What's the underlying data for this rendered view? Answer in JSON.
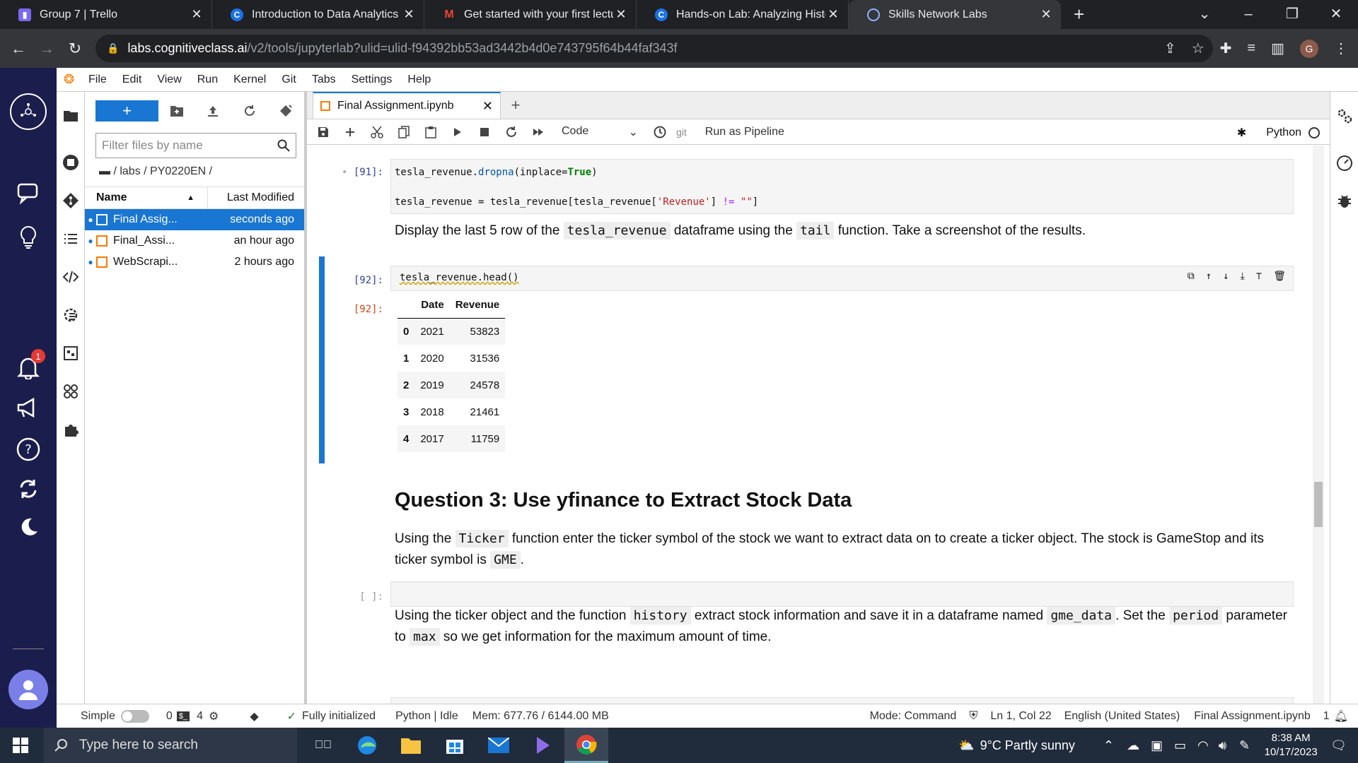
{
  "browser": {
    "tabs": [
      {
        "title": "Group 7 | Trello",
        "favicon": "trello-icon",
        "color": "#7b68ee"
      },
      {
        "title": "Introduction to Data Analytics | (",
        "favicon": "coursera-icon",
        "color": "#1a73e8"
      },
      {
        "title": "Get started with your first lectur",
        "favicon": "gmail-icon",
        "color": "#ea4335"
      },
      {
        "title": "Hands-on Lab: Analyzing Histori",
        "favicon": "coursera-icon",
        "color": "#1a73e8"
      },
      {
        "title": "Skills Network Labs",
        "favicon": "skills-network-icon",
        "color": "#4285f4"
      }
    ],
    "url_domain": "labs.cognitiveclass.ai",
    "url_path": "/v2/tools/jupyterlab?ulid=ulid-f94392bb53ad3442b4d0e743795f64b44faf343f",
    "profile_initial": "G"
  },
  "rail": {
    "notification_count": "1"
  },
  "menubar": {
    "items": [
      "File",
      "Edit",
      "View",
      "Run",
      "Kernel",
      "Git",
      "Tabs",
      "Settings",
      "Help"
    ]
  },
  "filebrowser": {
    "new_label": "+",
    "filter_placeholder": "Filter files by name",
    "breadcrumb": "/ labs / PY0220EN /",
    "col_name": "Name",
    "col_modified": "Last Modified",
    "files": [
      {
        "name": "Final Assig...",
        "modified": "seconds ago",
        "selected": true
      },
      {
        "name": "Final_Assi...",
        "modified": "an hour ago",
        "selected": false
      },
      {
        "name": "WebScrapi...",
        "modified": "2 hours ago",
        "selected": false
      }
    ]
  },
  "notebook": {
    "tab_title": "Final Assignment.ipynb",
    "cell_type": "Code",
    "git_label": "git",
    "run_pipeline": "Run as Pipeline",
    "kernel": "Python",
    "cells": {
      "c91_prompt": "[91]:",
      "c91_line1_a": "tesla_revenue.",
      "c91_line1_b": "dropna",
      "c91_line1_c": "(inplace=",
      "c91_line1_d": "True",
      "c91_line1_e": ")",
      "c91_line2_a": "tesla_revenue = tesla_revenue[tesla_revenue[",
      "c91_line2_b": "'Revenue'",
      "c91_line2_c": "] ",
      "c91_line2_d": "!=",
      "c91_line2_e": " ",
      "c91_line2_f": "\"\"",
      "c91_line2_g": "]",
      "md1_a": "Display the last 5 row of the ",
      "md1_code1": "tesla_revenue",
      "md1_b": " dataframe using the ",
      "md1_code2": "tail",
      "md1_c": " function. Take a screenshot of the results.",
      "c92_prompt": "[92]:",
      "c92_code": "tesla_revenue.head()",
      "out92_prompt": "[92]:",
      "heading": "Question 3: Use yfinance to Extract Stock Data",
      "md2_a": "Using the ",
      "md2_code1": "Ticker",
      "md2_b": " function enter the ticker symbol of the stock we want to extract data on to create a ticker object. The stock is GameStop and its ticker symbol is ",
      "md2_code2": "GME",
      "md2_c": ".",
      "empty_prompt": "[ ]:",
      "md3_a": "Using the ticker object and the function ",
      "md3_code1": "history",
      "md3_b": " extract stock information and save it in a dataframe named ",
      "md3_code2": "gme_data",
      "md3_c": ". Set the ",
      "md3_code3": "period",
      "md3_d": " parameter to ",
      "md3_code4": "max",
      "md3_e": " so we get information for the maximum amount of time."
    },
    "dataframe": {
      "columns": [
        "",
        "Date",
        "Revenue"
      ],
      "rows": [
        [
          "0",
          "2021",
          "53823"
        ],
        [
          "1",
          "2020",
          "31536"
        ],
        [
          "2",
          "2019",
          "24578"
        ],
        [
          "3",
          "2018",
          "21461"
        ],
        [
          "4",
          "2017",
          "11759"
        ]
      ]
    }
  },
  "statusbar": {
    "simple": "Simple",
    "count0": "0",
    "count4": "4",
    "initialized": "Fully initialized",
    "kernel_status": "Python | Idle",
    "mem": "Mem: 677.76 / 6144.00 MB",
    "mode": "Mode: Command",
    "position": "Ln 1, Col 22",
    "language": "English (United States)",
    "filename": "Final Assignment.ipynb",
    "notifications": "1"
  },
  "taskbar": {
    "search_placeholder": "Type here to search",
    "weather": "9°C  Partly sunny",
    "time": "8:38 AM",
    "date": "10/17/2023"
  },
  "colors": {
    "accent": "#1976d2",
    "rail": "#1b1d4d",
    "taskbar": "#202b3c"
  }
}
